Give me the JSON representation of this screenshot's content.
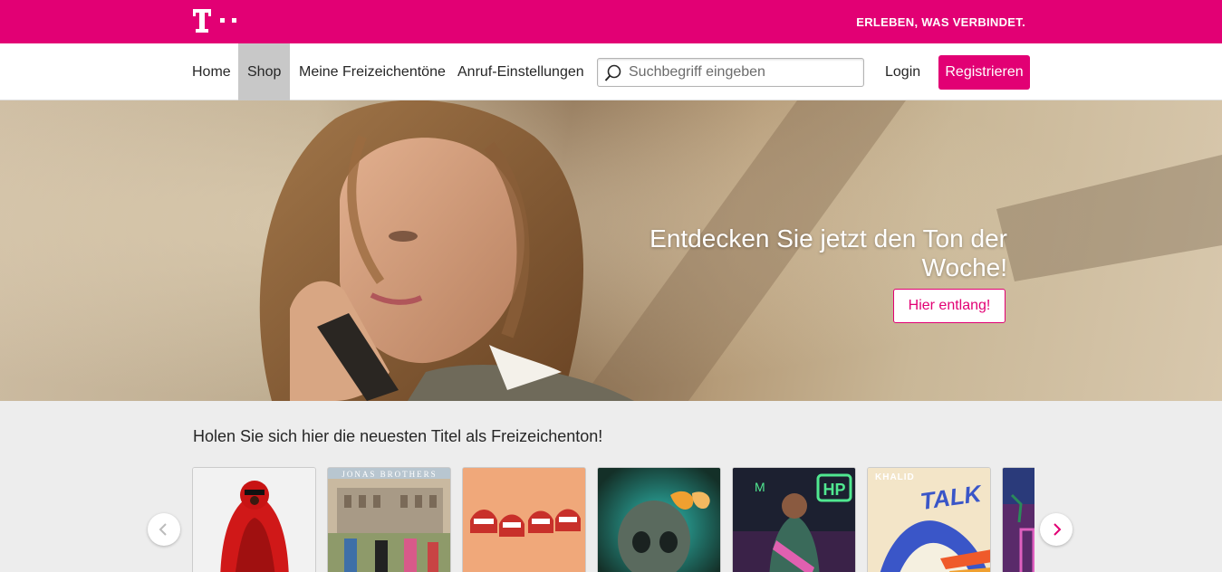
{
  "brand": {
    "logo_icon": "telekom-t-logo-icon",
    "slogan": "ERLEBEN, WAS VERBINDET.",
    "color": "#e20074"
  },
  "nav": {
    "items": [
      {
        "label": "Home",
        "active": false
      },
      {
        "label": "Shop",
        "active": true
      },
      {
        "label": "Meine Freizeichentöne",
        "active": false
      },
      {
        "label": "Anruf-Einstellungen",
        "active": false
      }
    ],
    "search_placeholder": "Suchbegriff eingeben",
    "login_label": "Login",
    "register_label": "Registrieren"
  },
  "hero": {
    "title": "Entdecken Sie jetzt den Ton der Woche!",
    "button_label": "Hier entlang!"
  },
  "section": {
    "title": "Holen Sie sich hier die neuesten Titel als Freizeichenton!",
    "covers": [
      {
        "name": "cover-red-fur",
        "bg": "#f2f2f2"
      },
      {
        "name": "cover-jonas-brothers",
        "caption": "JONAS BROTHERS",
        "bg": "#c9b9a0"
      },
      {
        "name": "cover-teeth",
        "bg": "#f0a87a"
      },
      {
        "name": "cover-skull",
        "bg": "#2a4a44"
      },
      {
        "name": "cover-hp",
        "caption": "HP",
        "bg": "#1a1a2a"
      },
      {
        "name": "cover-khalid-talk",
        "caption": "KHALID",
        "caption2": "TALK",
        "bg": "#f3e5c8"
      },
      {
        "name": "cover-neon",
        "bg": "#3a2a5a"
      }
    ]
  }
}
